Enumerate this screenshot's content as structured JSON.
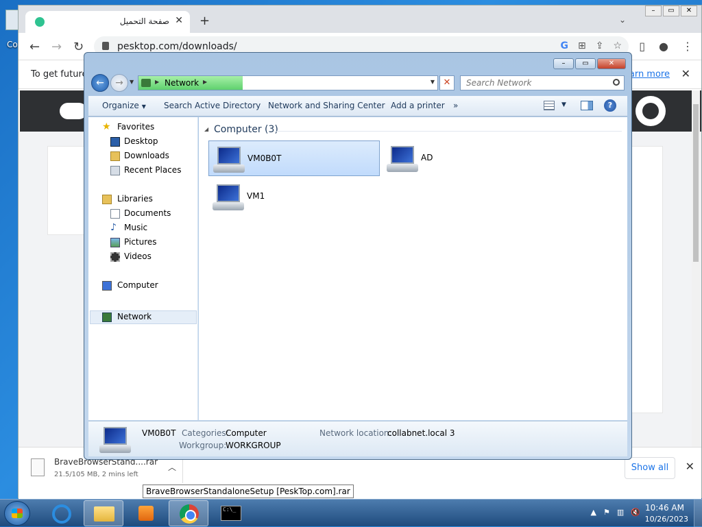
{
  "desktop": {
    "icon_label": "Co"
  },
  "chrome": {
    "tab_title": "صفحة التحميل",
    "url": "pesktop.com/downloads/",
    "infobar_text": "To get future",
    "infobar_link": "earn more",
    "download": {
      "file_name": "BraveBrowserStand....rar",
      "status": "21.5/105 MB, 2 mins left"
    },
    "show_all_label": "Show all",
    "tooltip": "BraveBrowserStandaloneSetup [PeskTop.com].rar"
  },
  "explorer": {
    "address": "Network",
    "search_placeholder": "Search Network",
    "commands": {
      "organize": "Organize",
      "search_ad": "Search Active Directory",
      "network_sharing": "Network and Sharing Center",
      "add_printer": "Add a printer",
      "more": "»"
    },
    "nav": {
      "favorites": "Favorites",
      "desktop": "Desktop",
      "downloads": "Downloads",
      "recent_places": "Recent Places",
      "libraries": "Libraries",
      "documents": "Documents",
      "music": "Music",
      "pictures": "Pictures",
      "videos": "Videos",
      "computer": "Computer",
      "network": "Network"
    },
    "group_header": "Computer (3)",
    "computers": [
      "VM0B0T",
      "AD",
      "VM1"
    ],
    "details": {
      "name": "VM0B0T",
      "categories_label": "Categories:",
      "categories_value": "Computer",
      "workgroup_label": "Workgroup:",
      "workgroup_value": "WORKGROUP",
      "location_label": "Network location:",
      "location_value": "collabnet.local  3"
    }
  },
  "taskbar": {
    "time": "10:46 AM",
    "date": "10/26/2023",
    "cmd_icon_text": "C:\\_"
  }
}
